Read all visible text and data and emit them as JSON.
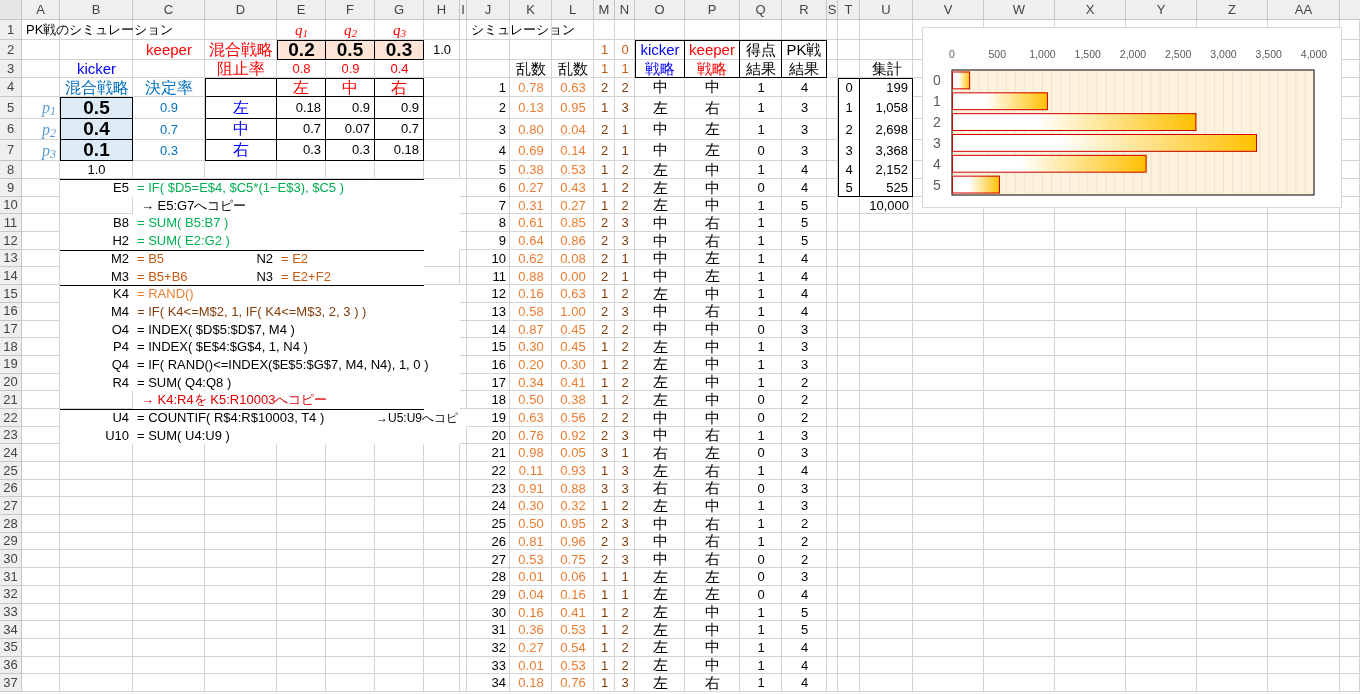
{
  "sheet": {
    "columns": [
      "A",
      "B",
      "C",
      "D",
      "E",
      "F",
      "G",
      "H",
      "I",
      "J",
      "K",
      "L",
      "M",
      "N",
      "O",
      "P",
      "Q",
      "R",
      "S",
      "T",
      "U",
      "V",
      "W",
      "X",
      "Y",
      "Z",
      "AA"
    ],
    "rows": [
      "1",
      "2",
      "3",
      "4",
      "5",
      "6",
      "7",
      "8",
      "9",
      "10",
      "11",
      "12",
      "13",
      "14",
      "15",
      "16",
      "17",
      "18",
      "19",
      "20",
      "21",
      "22",
      "23",
      "24",
      "25",
      "26",
      "27",
      "28",
      "29",
      "30",
      "31",
      "32",
      "33",
      "34",
      "35",
      "36",
      "37"
    ]
  },
  "title": "PK戦のシミュレーション",
  "keeper": {
    "label": "keeper",
    "strategy_label": "混合戦略",
    "block_label": "阻止率",
    "symbols": [
      "q$_{1}$",
      "q$_{2}$",
      "q$_{3}$"
    ],
    "strategy": [
      "0.2",
      "0.5",
      "0.3"
    ],
    "strategy_sum": "1.0",
    "block_rates": [
      "0.8",
      "0.9",
      "0.4"
    ],
    "directions": [
      "左",
      "中",
      "右"
    ]
  },
  "kicker": {
    "label": "kicker",
    "strategy_label": "混合戦略",
    "success_label": "決定率",
    "symbols": [
      "p$_{1}$",
      "p$_{2}$",
      "p$_{3}$"
    ],
    "strategy": [
      "0.5",
      "0.4",
      "0.1"
    ],
    "strategy_sum": "1.0",
    "success_rates": [
      "0.9",
      "0.7",
      "0.3"
    ],
    "directions": [
      "左",
      "中",
      "右"
    ]
  },
  "matrix": [
    [
      "0.18",
      "0.9",
      "0.9"
    ],
    [
      "0.7",
      "0.07",
      "0.7"
    ],
    [
      "0.3",
      "0.3",
      "0.18"
    ]
  ],
  "formulas": [
    {
      "kind": "formula",
      "divider_above": true,
      "cells": [
        {
          "ref": "E5",
          "expr": "= IF( $D5=E$4, $C5*(1−E$3), $C5 )",
          "color": "#00b050"
        }
      ]
    },
    {
      "kind": "note",
      "divider_above": false,
      "text": "→ E5:G7へコピー",
      "color": "#000000"
    },
    {
      "kind": "formula",
      "divider_above": false,
      "cells": [
        {
          "ref": "B8",
          "expr": "= SUM( B5:B7 )",
          "color": "#00b050"
        }
      ]
    },
    {
      "kind": "formula",
      "divider_above": false,
      "cells": [
        {
          "ref": "H2",
          "expr": "= SUM( E2:G2 )",
          "color": "#00b050"
        }
      ]
    },
    {
      "kind": "formula",
      "divider_above": true,
      "cells": [
        {
          "ref": "M2",
          "expr": "= B5",
          "color": "#c55a11"
        },
        {
          "ref": "N2",
          "expr": "= E2",
          "color": "#c55a11"
        }
      ]
    },
    {
      "kind": "formula",
      "divider_above": false,
      "cells": [
        {
          "ref": "M3",
          "expr": "= B5+B6",
          "color": "#c55a11"
        },
        {
          "ref": "N3",
          "expr": "= E2+F2",
          "color": "#c55a11"
        }
      ]
    },
    {
      "kind": "formula",
      "divider_above": true,
      "cells": [
        {
          "ref": "K4",
          "expr": "= RAND()",
          "color": "#ed7d31"
        }
      ]
    },
    {
      "kind": "formula",
      "divider_above": false,
      "cells": [
        {
          "ref": "M4",
          "expr": "= IF( K4<=M$2, 1, IF( K4<=M$3, 2, 3 ) )",
          "color": "#843c0c"
        }
      ]
    },
    {
      "kind": "formula",
      "divider_above": false,
      "cells": [
        {
          "ref": "O4",
          "expr": "= INDEX( $D$5:$D$7, M4 )",
          "color": "#000000"
        }
      ]
    },
    {
      "kind": "formula",
      "divider_above": false,
      "cells": [
        {
          "ref": "P4",
          "expr": "= INDEX( $E$4:$G$4, 1, N4 )",
          "color": "#000000"
        }
      ]
    },
    {
      "kind": "formula",
      "divider_above": false,
      "cells": [
        {
          "ref": "Q4",
          "expr": "= IF( RAND()<=INDEX($E$5:$G$7, M4, N4), 1, 0 )",
          "color": "#000000"
        }
      ]
    },
    {
      "kind": "formula",
      "divider_above": false,
      "cells": [
        {
          "ref": "R4",
          "expr": "= SUM( Q4:Q8 )",
          "color": "#000000"
        }
      ]
    },
    {
      "kind": "note",
      "divider_above": false,
      "text": "→ K4:R4を  K5:R10003へコピー",
      "color": "#e00000"
    },
    {
      "kind": "formula",
      "divider_above": true,
      "cells": [
        {
          "ref": "U4",
          "expr": "= COUNTIF( R$4:R$10003, T4 )",
          "color": "#000000"
        }
      ],
      "aside": "→U5:U9へコピ"
    },
    {
      "kind": "formula",
      "divider_above": false,
      "cells": [
        {
          "ref": "U10",
          "expr": "= SUM( U4:U9 )",
          "color": "#000000"
        }
      ]
    }
  ],
  "simulation": {
    "title": "シミュレーション",
    "thresholds": [
      [
        "1",
        "0"
      ],
      [
        "1",
        "1"
      ]
    ],
    "random_labels": [
      "乱数",
      "乱数"
    ],
    "headers": [
      {
        "kind": "kicker",
        "lines": [
          "kicker",
          "戦略"
        ]
      },
      {
        "kind": "keeper",
        "lines": [
          "keeper",
          "戦略"
        ]
      },
      {
        "kind": "plain",
        "lines": [
          "得点",
          "結果"
        ]
      },
      {
        "kind": "plain",
        "lines": [
          "PK戦",
          "結果"
        ]
      }
    ],
    "rows": [
      [
        "1",
        "0.78",
        "0.63",
        "2",
        "2",
        "中",
        "中",
        "1",
        "4"
      ],
      [
        "2",
        "0.13",
        "0.95",
        "1",
        "3",
        "左",
        "右",
        "1",
        "3"
      ],
      [
        "3",
        "0.80",
        "0.04",
        "2",
        "1",
        "中",
        "左",
        "1",
        "3"
      ],
      [
        "4",
        "0.69",
        "0.14",
        "2",
        "1",
        "中",
        "左",
        "0",
        "3"
      ],
      [
        "5",
        "0.38",
        "0.53",
        "1",
        "2",
        "左",
        "中",
        "1",
        "4"
      ],
      [
        "6",
        "0.27",
        "0.43",
        "1",
        "2",
        "左",
        "中",
        "0",
        "4"
      ],
      [
        "7",
        "0.31",
        "0.27",
        "1",
        "2",
        "左",
        "中",
        "1",
        "5"
      ],
      [
        "8",
        "0.61",
        "0.85",
        "2",
        "3",
        "中",
        "右",
        "1",
        "5"
      ],
      [
        "9",
        "0.64",
        "0.86",
        "2",
        "3",
        "中",
        "右",
        "1",
        "5"
      ],
      [
        "10",
        "0.62",
        "0.08",
        "2",
        "1",
        "中",
        "左",
        "1",
        "4"
      ],
      [
        "11",
        "0.88",
        "0.00",
        "2",
        "1",
        "中",
        "左",
        "1",
        "4"
      ],
      [
        "12",
        "0.16",
        "0.63",
        "1",
        "2",
        "左",
        "中",
        "1",
        "4"
      ],
      [
        "13",
        "0.58",
        "1.00",
        "2",
        "3",
        "中",
        "右",
        "1",
        "4"
      ],
      [
        "14",
        "0.87",
        "0.45",
        "2",
        "2",
        "中",
        "中",
        "0",
        "3"
      ],
      [
        "15",
        "0.30",
        "0.45",
        "1",
        "2",
        "左",
        "中",
        "1",
        "3"
      ],
      [
        "16",
        "0.20",
        "0.30",
        "1",
        "2",
        "左",
        "中",
        "1",
        "3"
      ],
      [
        "17",
        "0.34",
        "0.41",
        "1",
        "2",
        "左",
        "中",
        "1",
        "2"
      ],
      [
        "18",
        "0.50",
        "0.38",
        "1",
        "2",
        "左",
        "中",
        "0",
        "2"
      ],
      [
        "19",
        "0.63",
        "0.56",
        "2",
        "2",
        "中",
        "中",
        "0",
        "2"
      ],
      [
        "20",
        "0.76",
        "0.92",
        "2",
        "3",
        "中",
        "右",
        "1",
        "3"
      ],
      [
        "21",
        "0.98",
        "0.05",
        "3",
        "1",
        "右",
        "左",
        "0",
        "3"
      ],
      [
        "22",
        "0.11",
        "0.93",
        "1",
        "3",
        "左",
        "右",
        "1",
        "4"
      ],
      [
        "23",
        "0.91",
        "0.88",
        "3",
        "3",
        "右",
        "右",
        "0",
        "3"
      ],
      [
        "24",
        "0.30",
        "0.32",
        "1",
        "2",
        "左",
        "中",
        "1",
        "3"
      ],
      [
        "25",
        "0.50",
        "0.95",
        "2",
        "3",
        "中",
        "右",
        "1",
        "2"
      ],
      [
        "26",
        "0.81",
        "0.96",
        "2",
        "3",
        "中",
        "右",
        "1",
        "2"
      ],
      [
        "27",
        "0.53",
        "0.75",
        "2",
        "3",
        "中",
        "右",
        "0",
        "2"
      ],
      [
        "28",
        "0.01",
        "0.06",
        "1",
        "1",
        "左",
        "左",
        "0",
        "3"
      ],
      [
        "29",
        "0.04",
        "0.16",
        "1",
        "1",
        "左",
        "左",
        "0",
        "4"
      ],
      [
        "30",
        "0.16",
        "0.41",
        "1",
        "2",
        "左",
        "中",
        "1",
        "5"
      ],
      [
        "31",
        "0.36",
        "0.53",
        "1",
        "2",
        "左",
        "中",
        "1",
        "5"
      ],
      [
        "32",
        "0.27",
        "0.54",
        "1",
        "2",
        "左",
        "中",
        "1",
        "4"
      ],
      [
        "33",
        "0.01",
        "0.53",
        "1",
        "2",
        "左",
        "中",
        "1",
        "4"
      ],
      [
        "34",
        "0.18",
        "0.76",
        "1",
        "3",
        "左",
        "右",
        "1",
        "4"
      ]
    ]
  },
  "tally": {
    "label": "集計",
    "rows": [
      [
        "0",
        "199"
      ],
      [
        "1",
        "1,058"
      ],
      [
        "2",
        "2,698"
      ],
      [
        "3",
        "3,368"
      ],
      [
        "4",
        "2,152"
      ],
      [
        "5",
        "525"
      ]
    ],
    "total": "10,000",
    "chart_data": {
      "type": "bar",
      "orientation": "horizontal",
      "categories": [
        "0",
        "1",
        "2",
        "3",
        "4",
        "5"
      ],
      "series": [
        {
          "color": "#ffc000",
          "values": [
            200,
            1060,
            2700,
            3370,
            2150,
            530
          ]
        }
      ],
      "xlim": [
        0,
        4000
      ],
      "grid": true,
      "xticks": [
        {
          "value": 0,
          "label": "0"
        },
        {
          "value": 500,
          "label": "500"
        },
        {
          "value": 1000,
          "label": "1,000"
        },
        {
          "value": 1500,
          "label": "1,500"
        },
        {
          "value": 2000,
          "label": "2,000"
        },
        {
          "value": 2500,
          "label": "2,500"
        },
        {
          "value": 3000,
          "label": "3,000"
        },
        {
          "value": 3500,
          "label": "3,500"
        },
        {
          "value": 4000,
          "label": "4,000"
        }
      ]
    }
  }
}
